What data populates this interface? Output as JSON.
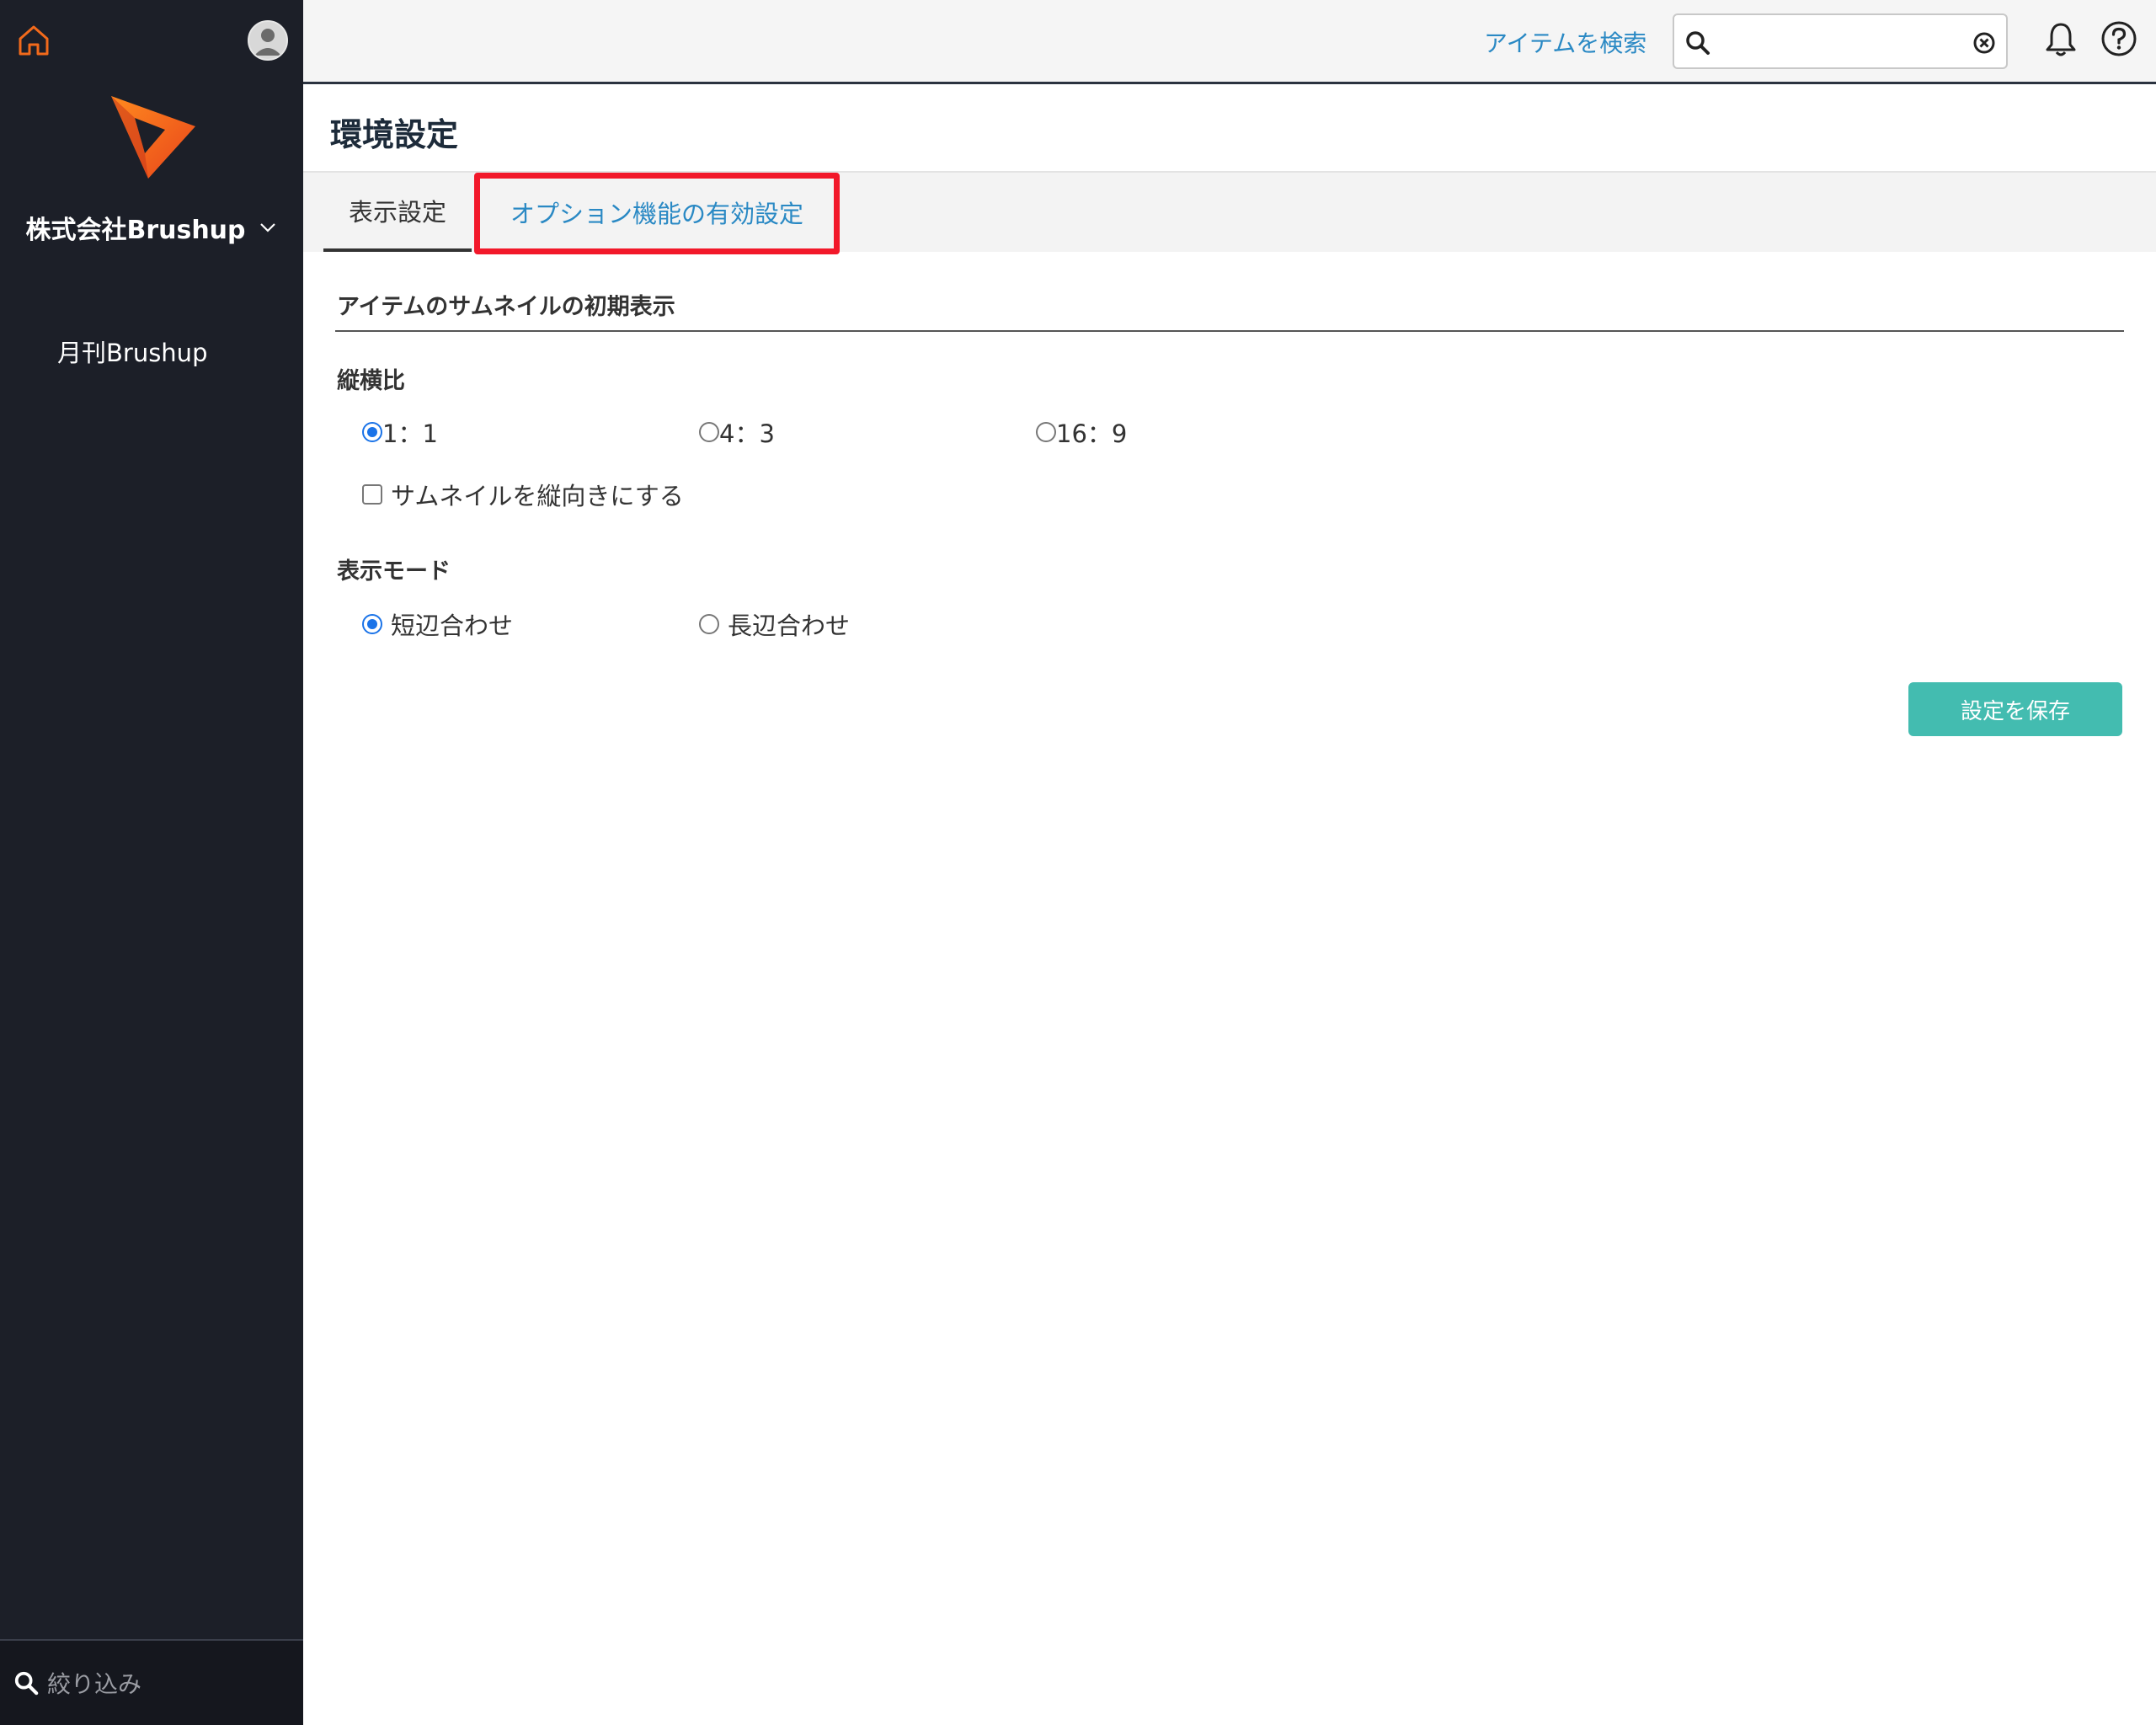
{
  "sidebar": {
    "company_name": "株式会社Brushup",
    "project": "月刊Brushup",
    "filter_placeholder": "絞り込み",
    "icons": [
      "home-icon",
      "avatar",
      "logo",
      "chevron-down-icon",
      "search-icon"
    ]
  },
  "header": {
    "search_label": "アイテムを検索",
    "search_value": "",
    "icons": [
      "search-icon",
      "clear-icon",
      "bell-icon",
      "help-icon"
    ]
  },
  "page": {
    "title": "環境設定"
  },
  "tabs": [
    {
      "label": "表示設定",
      "active": true
    },
    {
      "label": "オプション機能の有効設定",
      "active": false,
      "highlighted": true
    }
  ],
  "thumbnail_section": {
    "title": "アイテムのサムネイルの初期表示",
    "aspect_label": "縦横比",
    "aspect_options": [
      {
        "label": "1：1",
        "selected": true
      },
      {
        "label": "4：3",
        "selected": false
      },
      {
        "label": "16：9",
        "selected": false
      }
    ],
    "portrait_checkbox": {
      "label": "サムネイルを縦向きにする",
      "checked": false
    },
    "mode_label": "表示モード",
    "mode_options": [
      {
        "label": "短辺合わせ",
        "selected": true
      },
      {
        "label": "長辺合わせ",
        "selected": false
      }
    ]
  },
  "save_button": "設定を保存",
  "colors": {
    "sidebar_bg": "#1c1f28",
    "accent_link": "#2a89c4",
    "save_button": "#43bcb0",
    "highlight": "#f2182a",
    "logo_orange": "#f26a1b"
  }
}
